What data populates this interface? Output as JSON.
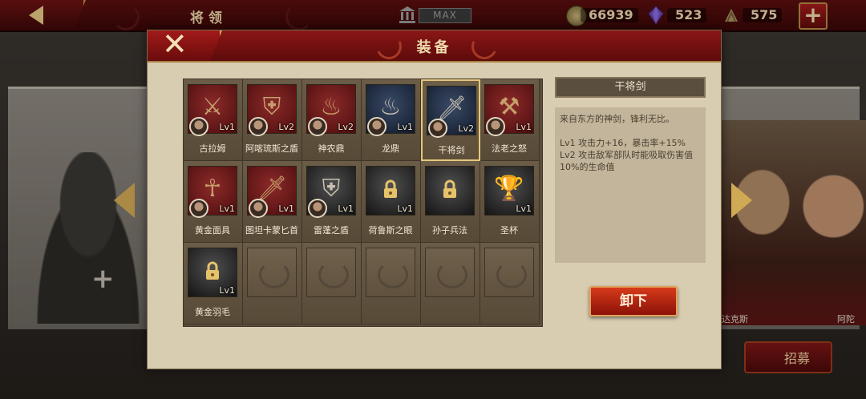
{
  "topbar": {
    "title": "将领",
    "max_label": "MAX",
    "coins": "66939",
    "gems": "523",
    "food": "575",
    "plus_label": "+"
  },
  "background": {
    "add_label": "+",
    "hero_names": [
      "达克斯",
      "阿陀"
    ],
    "recruit_label": "招募"
  },
  "modal": {
    "title": "装备",
    "close_label": "✕",
    "items": [
      {
        "name": "古拉姆",
        "level": "Lv1",
        "icon": "sword-icon",
        "locked": false
      },
      {
        "name": "阿喀琉斯之盾",
        "level": "Lv2",
        "icon": "shield-icon",
        "locked": false
      },
      {
        "name": "神农鼎",
        "level": "Lv2",
        "icon": "cauldron-icon",
        "locked": false
      },
      {
        "name": "龙鼎",
        "level": "Lv1",
        "icon": "cauldron-icon",
        "locked": false
      },
      {
        "name": "干将剑",
        "level": "Lv2",
        "icon": "sword-icon",
        "locked": false,
        "selected": true
      },
      {
        "name": "法老之怒",
        "level": "Lv1",
        "icon": "axe-icon",
        "locked": false
      },
      {
        "name": "黄金面具",
        "level": "Lv1",
        "icon": "mask-icon",
        "locked": false
      },
      {
        "name": "图坦卡蒙匕首",
        "level": "Lv1",
        "icon": "dagger-icon",
        "locked": false
      },
      {
        "name": "雷蓬之盾",
        "level": "Lv1",
        "icon": "shield-icon",
        "locked": false
      },
      {
        "name": "荷鲁斯之眼",
        "level": "Lv1",
        "icon": "lock-icon",
        "locked": true
      },
      {
        "name": "孙子兵法",
        "level": "",
        "icon": "lock-icon",
        "locked": true
      },
      {
        "name": "圣杯",
        "level": "Lv1",
        "icon": "chalice-icon",
        "locked": false
      },
      {
        "name": "黄金羽毛",
        "level": "Lv1",
        "icon": "lock-icon",
        "locked": true
      }
    ],
    "detail": {
      "title": "干将剑",
      "description": "来自东方的神剑，锋利无比。",
      "effects": [
        "Lv1  攻击力+16，暴击率+15%",
        "Lv2  攻击敌军部队时能吸取伤害值10%的生命值"
      ]
    },
    "unequip_label": "卸下"
  },
  "colors": {
    "accent_red": "#8a1616",
    "gold": "#e6c77d",
    "panel_bg": "#d8ccb1"
  }
}
